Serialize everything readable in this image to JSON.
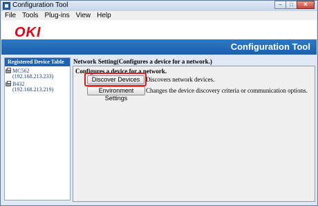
{
  "window": {
    "title": "Configuration Tool",
    "controls": {
      "minimize": "–",
      "maximize": "□",
      "close": "✕"
    }
  },
  "menu": {
    "items": [
      "File",
      "Tools",
      "Plug-ins",
      "View",
      "Help"
    ]
  },
  "header": {
    "logo": "OKI",
    "banner_title": "Configuration Tool"
  },
  "sidebar": {
    "heading": "Registered Device Table",
    "devices": [
      {
        "name": "MC562",
        "ip": "(192.168.213.233)",
        "icon": "printer-icon"
      },
      {
        "name": "B432",
        "ip": "(192.168.213.219)",
        "icon": "printer-icon"
      }
    ]
  },
  "main": {
    "title": "Network Setting(Configures a device for a network.)",
    "panel_heading": "Configures a device for a network.",
    "actions": [
      {
        "label": "Discover Devices",
        "description": "Discovers network devices."
      },
      {
        "label": "Environment Settings",
        "description": "Changes the device discovery criteria or communication options."
      }
    ]
  },
  "colors": {
    "brand_red": "#e60012",
    "banner_blue": "#1660ae",
    "highlight_red": "#e21a1a"
  }
}
